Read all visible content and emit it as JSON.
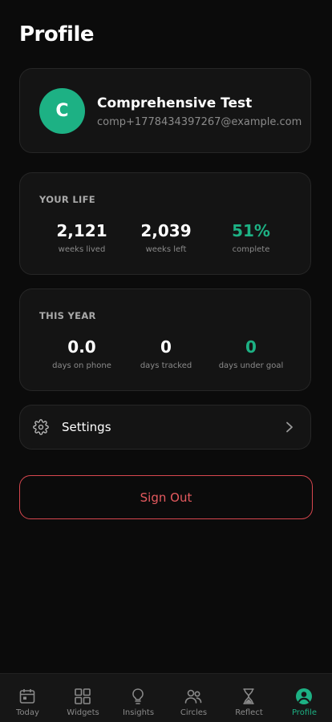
{
  "page": {
    "title": "Profile"
  },
  "profile": {
    "initial": "C",
    "name": "Comprehensive Test",
    "email": "comp+1778434397267@example.com"
  },
  "your_life": {
    "label": "YOUR LIFE",
    "stats": [
      {
        "value": "2,121",
        "label": "weeks lived"
      },
      {
        "value": "2,039",
        "label": "weeks left"
      },
      {
        "value": "51%",
        "label": "complete"
      }
    ]
  },
  "this_year": {
    "label": "THIS YEAR",
    "stats": [
      {
        "value": "0.0",
        "label": "days on phone"
      },
      {
        "value": "0",
        "label": "days tracked"
      },
      {
        "value": "0",
        "label": "days under goal"
      }
    ]
  },
  "settings": {
    "label": "Settings"
  },
  "sign_out": {
    "label": "Sign Out"
  },
  "tabs": [
    {
      "label": "Today",
      "icon": "calendar-icon"
    },
    {
      "label": "Widgets",
      "icon": "grid-icon"
    },
    {
      "label": "Insights",
      "icon": "lightbulb-icon"
    },
    {
      "label": "Circles",
      "icon": "people-icon"
    },
    {
      "label": "Reflect",
      "icon": "hourglass-icon"
    },
    {
      "label": "Profile",
      "icon": "user-circle-icon",
      "active": true
    }
  ],
  "colors": {
    "accent": "#1db184",
    "danger": "#e55a5f",
    "background": "#0b0b0b",
    "card": "#141414"
  }
}
